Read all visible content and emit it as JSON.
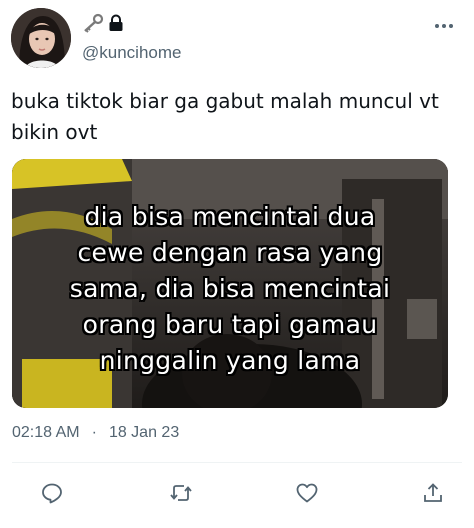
{
  "user": {
    "handle": "@kuncihome",
    "avatar_icon": "profile-photo",
    "badges": [
      "key-icon",
      "lock-icon"
    ]
  },
  "tweet": {
    "text_lines": [
      "buka tiktok biar ga gabut malah muncul vt",
      "bikin ovt"
    ],
    "media_caption_lines": [
      "dia bisa mencintai dua",
      "cewe dengan rasa yang",
      "sama, dia bisa mencintai",
      "orang baru tapi gamau",
      "ninggalin yang lama"
    ],
    "time": "02:18 AM",
    "separator": "·",
    "date": "18 Jan 23"
  },
  "actions": [
    "reply-icon",
    "retweet-icon",
    "like-icon",
    "share-icon"
  ],
  "colors": {
    "text": "#0f1419",
    "secondary": "#536471",
    "divider": "#eff3f4"
  }
}
